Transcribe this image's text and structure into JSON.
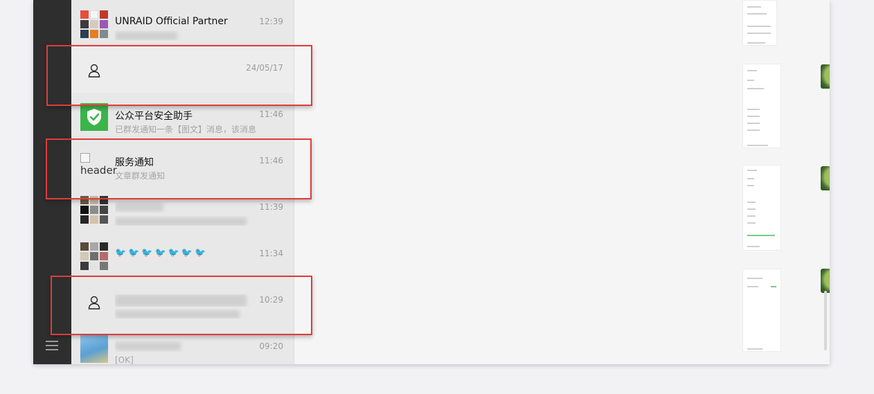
{
  "sidebar": {
    "menu_icon": "hamburger-menu-icon"
  },
  "chats": [
    {
      "name": "UNRAID Official Partner",
      "time": "12:39",
      "preview": "",
      "avatar": "group-grid"
    },
    {
      "name": "",
      "time": "24/05/17",
      "preview": "",
      "avatar": "user-placeholder-icon"
    },
    {
      "name": "公众平台安全助手",
      "time": "11:46",
      "preview": "已群发通知一条【图文】消息，该消息",
      "avatar": "shield-check-icon"
    },
    {
      "name": "服务通知",
      "time": "11:46",
      "preview": "文章群发通知",
      "avatar": "broken-image",
      "avatar_alt": "header"
    },
    {
      "name": "",
      "time": "11:39",
      "preview": "",
      "avatar": "group-grid"
    },
    {
      "name": "🐦🐦🐦🐦🐦🐦🐦",
      "time": "11:34",
      "preview": "",
      "avatar": "group-grid"
    },
    {
      "name": "",
      "time": "10:29",
      "preview": "",
      "avatar": "user-placeholder-icon"
    },
    {
      "name": "",
      "time": "09:20",
      "preview": "[OK]",
      "avatar": "photo"
    }
  ],
  "colors": {
    "highlight": "#e13b3b",
    "nav_bg": "#2e2e2e",
    "list_bg": "#e9e8e8",
    "shield_green": "#3ab54a"
  }
}
